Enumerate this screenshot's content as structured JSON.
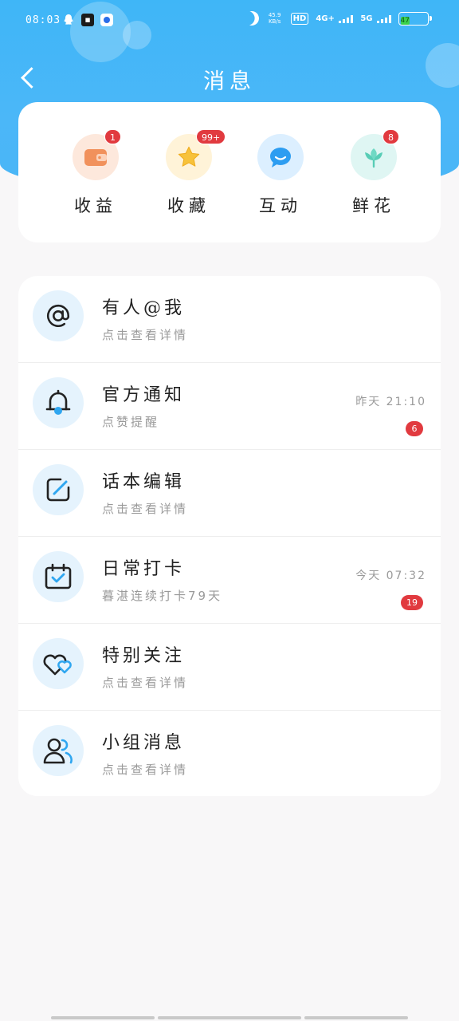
{
  "status_bar": {
    "time": "08:03",
    "speed_value": "45.9",
    "speed_unit": "KB/s",
    "hd_label": "HD",
    "sim1_label": "4G+",
    "sim2_label": "5G",
    "battery": "47"
  },
  "nav": {
    "title": "消息",
    "back_icon": "chevron-left-icon"
  },
  "quick_actions": [
    {
      "label": "收益",
      "icon": "wallet-icon",
      "badge": "1",
      "bg": "#fde8dc",
      "color": "#f1915c"
    },
    {
      "label": "收藏",
      "icon": "star-icon",
      "badge": "99+",
      "bg": "#fff3d8",
      "color": "#f7c23b"
    },
    {
      "label": "互动",
      "icon": "chat-bubble-icon",
      "badge": "",
      "bg": "#dcefff",
      "color": "#2d9df1"
    },
    {
      "label": "鲜花",
      "icon": "flower-icon",
      "badge": "8",
      "bg": "#dff6f3",
      "color": "#58cdb6"
    }
  ],
  "messages": [
    {
      "title": "有人@我",
      "subtitle": "点击查看详情",
      "time": "",
      "badge": "",
      "icon": "at-sign-icon"
    },
    {
      "title": "官方通知",
      "subtitle": "点赞提醒",
      "time": "昨天 21:10",
      "badge": "6",
      "icon": "bell-icon"
    },
    {
      "title": "话本编辑",
      "subtitle": "点击查看详情",
      "time": "",
      "badge": "",
      "icon": "edit-icon"
    },
    {
      "title": "日常打卡",
      "subtitle": "暮湛连续打卡79天",
      "time": "今天 07:32",
      "badge": "19",
      "icon": "calendar-check-icon"
    },
    {
      "title": "特别关注",
      "subtitle": "点击查看详情",
      "time": "",
      "badge": "",
      "icon": "hearts-icon"
    },
    {
      "title": "小组消息",
      "subtitle": "点击查看详情",
      "time": "",
      "badge": "",
      "icon": "group-icon"
    }
  ],
  "colors": {
    "header_blue": "#4ab5f6",
    "badge_red": "#e13a3f",
    "icon_accent": "#2fa6f0"
  }
}
